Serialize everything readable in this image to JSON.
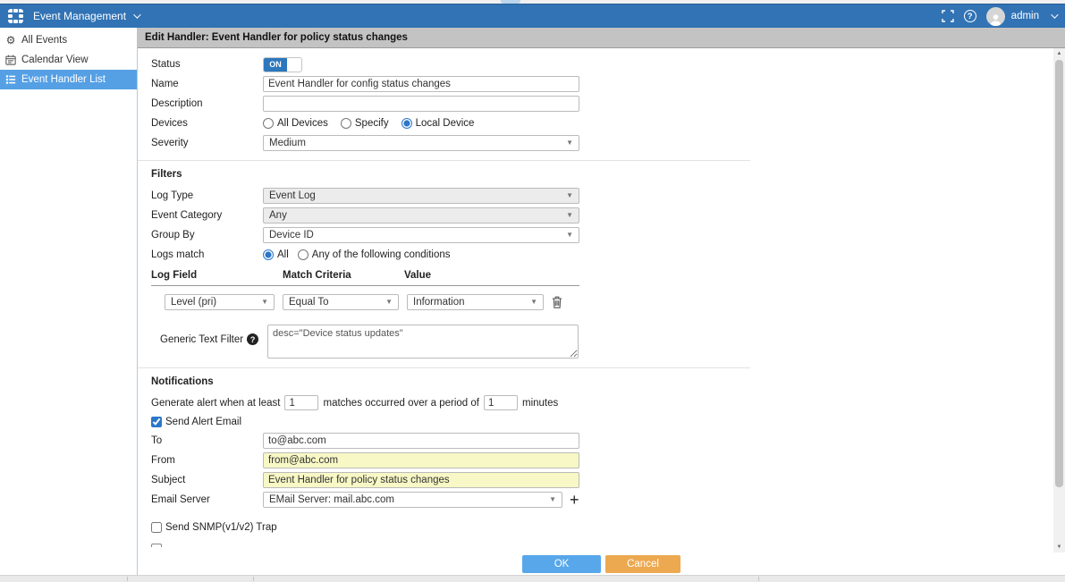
{
  "topbar": {
    "app_title": "Event Management",
    "user_name": "admin"
  },
  "sidebar": {
    "items": [
      {
        "label": "All Events",
        "icon": "gear-icon",
        "selected": false
      },
      {
        "label": "Calendar View",
        "icon": "calendar-icon",
        "selected": false
      },
      {
        "label": "Event Handler List",
        "icon": "list-icon",
        "selected": true
      }
    ]
  },
  "content_header": {
    "title": "Edit Handler: Event Handler for policy status changes"
  },
  "form": {
    "status": {
      "label": "Status",
      "value": "ON",
      "on": true
    },
    "name": {
      "label": "Name",
      "value": "Event Handler for config status changes"
    },
    "description": {
      "label": "Description",
      "value": ""
    },
    "devices": {
      "label": "Devices",
      "options": [
        {
          "label": "All Devices",
          "selected": false
        },
        {
          "label": "Specify",
          "selected": false
        },
        {
          "label": "Local Device",
          "selected": true
        }
      ]
    },
    "severity": {
      "label": "Severity",
      "value": "Medium"
    },
    "filters": {
      "section_title": "Filters",
      "log_type": {
        "label": "Log Type",
        "value": "Event Log"
      },
      "event_category": {
        "label": "Event Category",
        "value": "Any"
      },
      "group_by": {
        "label": "Group By",
        "value": "Device ID"
      },
      "logs_match": {
        "label": "Logs match",
        "options": [
          {
            "label": "All",
            "selected": true
          },
          {
            "label": "Any of the following conditions",
            "selected": false
          }
        ]
      },
      "conditions_columns": [
        "Log Field",
        "Match Criteria",
        "Value"
      ],
      "conditions": [
        {
          "log_field": "Level (pri)",
          "match_criteria": "Equal To",
          "value": "Information"
        }
      ],
      "generic_text_filter": {
        "label": "Generic Text Filter",
        "value": "desc=\"Device status updates\""
      }
    },
    "notifications": {
      "section_title": "Notifications",
      "generate_alert_prefix": "Generate alert when at least",
      "matches_value": "1",
      "generate_alert_middle": "matches occurred over a period of",
      "period_value": "1",
      "generate_alert_suffix": "minutes",
      "send_alert_email": {
        "label": "Send Alert Email",
        "checked": true
      },
      "to": {
        "label": "To",
        "value": "to@abc.com"
      },
      "from": {
        "label": "From",
        "value": "from@abc.com"
      },
      "subject": {
        "label": "Subject",
        "value": "Event Handler for policy status changes"
      },
      "email_server": {
        "label": "Email Server",
        "value": "EMail Server: mail.abc.com"
      },
      "send_snmp": {
        "label": "Send SNMP(v1/v2) Trap",
        "checked": false
      }
    }
  },
  "footer": {
    "ok_label": "OK",
    "cancel_label": "Cancel"
  },
  "colors": {
    "topbar_blue": "#3173b4",
    "sidebar_selected_blue": "#55a0e5",
    "toggle_on_blue": "#2d77bd",
    "ok_button_blue": "#58a7ea",
    "cancel_button_orange": "#eca94f",
    "highlight_yellow": "#f8f8c6",
    "header_bar_gray": "#c3c3c3",
    "disabled_select_gray": "#ececec"
  }
}
